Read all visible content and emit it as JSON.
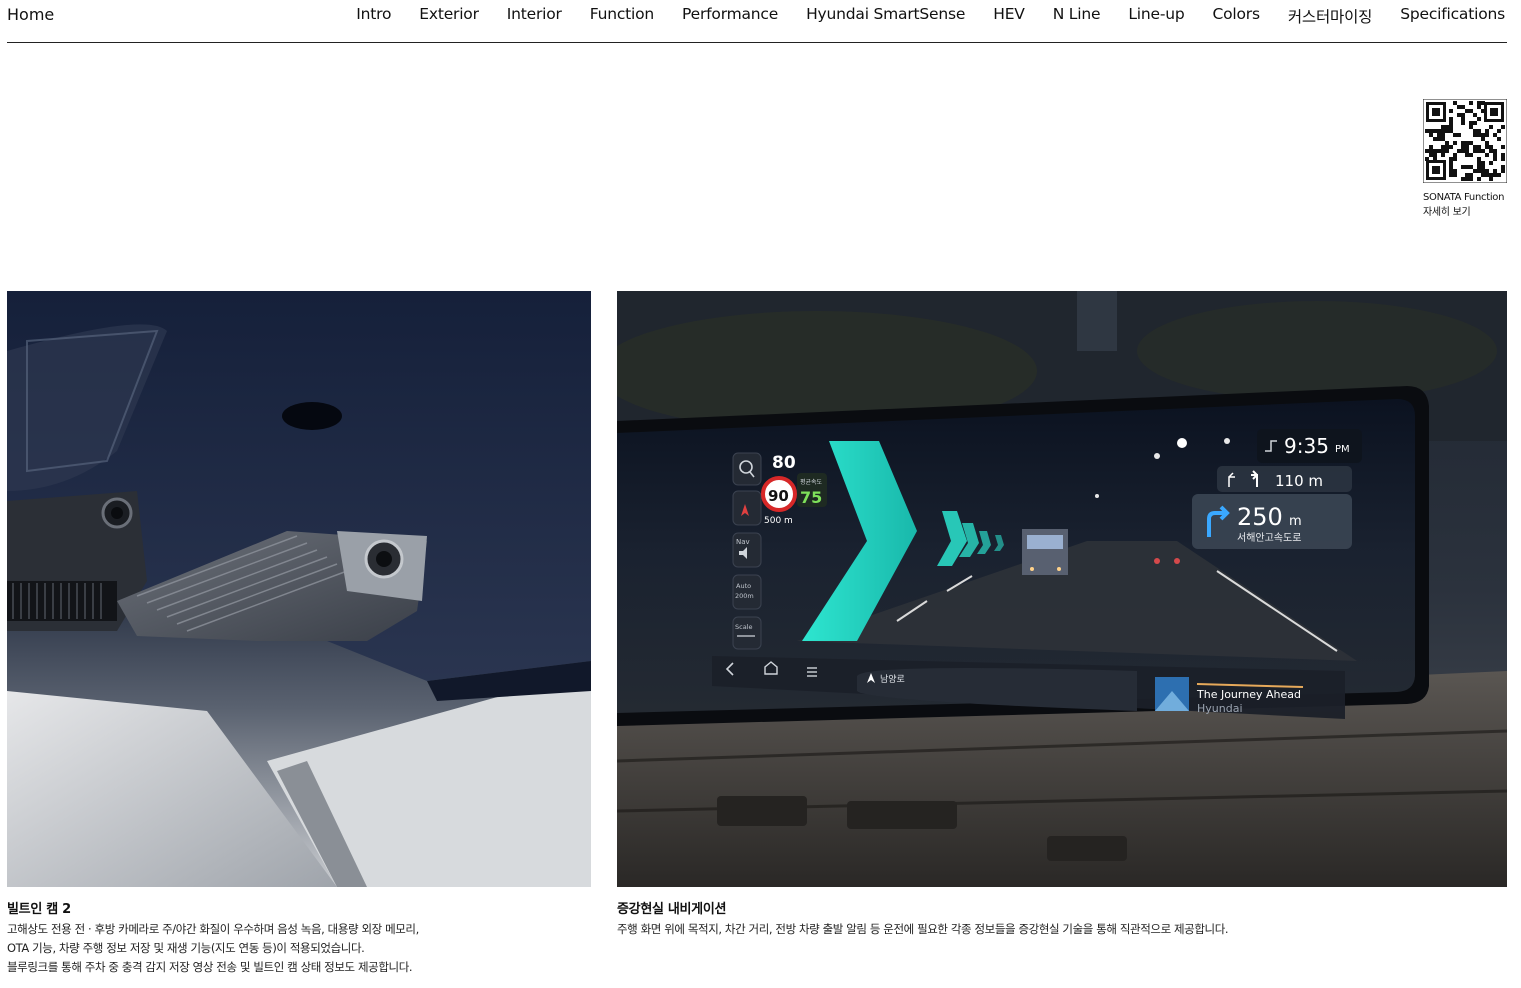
{
  "nav": {
    "home": "Home",
    "links": [
      {
        "label": "Intro"
      },
      {
        "label": "Exterior"
      },
      {
        "label": "Interior"
      },
      {
        "label": "Function"
      },
      {
        "label": "Performance"
      },
      {
        "label": "Hyundai SmartSense"
      },
      {
        "label": "HEV"
      },
      {
        "label": "N Line"
      },
      {
        "label": "Line-up"
      },
      {
        "label": "Colors"
      },
      {
        "label": "커스터마이징"
      },
      {
        "label": "Specifications"
      }
    ]
  },
  "qr": {
    "line1": "SONATA Function",
    "line2": "자세히 보기"
  },
  "features": [
    {
      "title": "빌트인 캠 2",
      "lines": [
        "고해상도 전용 전 · 후방 카메라로 주/야간 화질이 우수하며 음성 녹음, 대용량 외장 메모리,",
        "OTA 기능, 차량 주행 정보 저장 및 재생 기능(지도 연동 등)이 적용되었습니다.",
        "블루링크를 통해 주차 중 충격 감지 저장 영상 전송 및 빌트인 캠 상태 정보도 제공합니다."
      ]
    },
    {
      "title": "증강현실 내비게이션",
      "lines": [
        "주행 화면 위에 목적지, 차간 거리, 전방 차량 출발 알림 등 운전에 필요한 각종 정보들을 증강현실 기술을 통해 직관적으로 제공합니다."
      ]
    }
  ],
  "nav_screen": {
    "speed_limit": "80",
    "limit_sign": "90",
    "current_speed": "75",
    "avg_speed_label": "평균속도",
    "distance_small": "500 m",
    "time": "9:35",
    "time_suffix": "PM",
    "next_turn_distance": "110 m",
    "turn_distance_value": "250",
    "turn_distance_unit": "m",
    "turn_road": "서해안고속도로",
    "current_road": "남양로",
    "side_nav": "Nav",
    "side_auto": "Auto",
    "side_auto_dist": "200m",
    "side_scale": "Scale",
    "media_title": "The Journey Ahead",
    "media_artist": "Hyundai"
  }
}
